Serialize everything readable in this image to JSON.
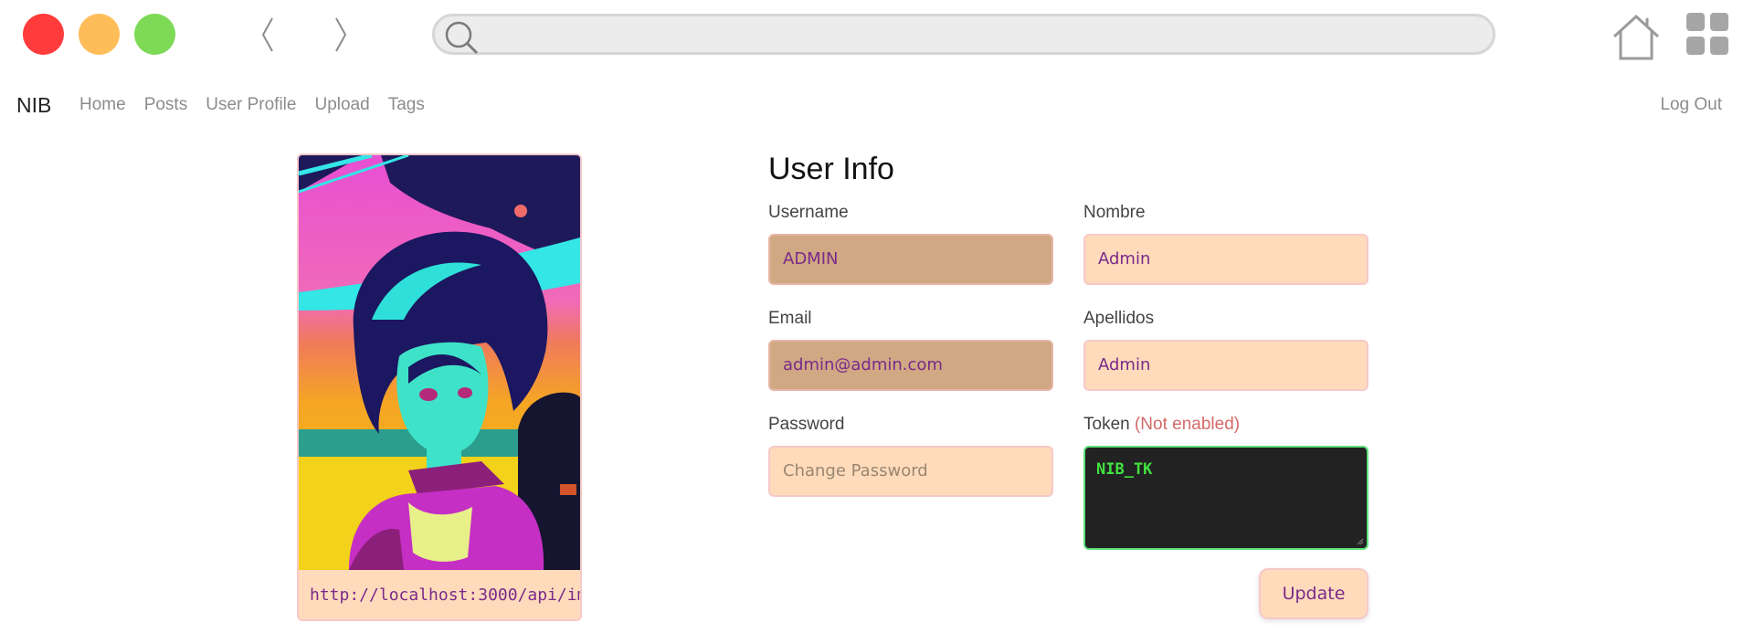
{
  "browser": {
    "icons": {
      "close": "red-dot",
      "minimize": "yellow-dot",
      "maximize": "green-dot",
      "back": "chevron-left-icon",
      "forward": "chevron-right-icon",
      "search": "search-icon",
      "home": "home-icon",
      "apps": "grid-icon"
    },
    "address_value": ""
  },
  "navbar": {
    "brand": "NIB",
    "links": [
      "Home",
      "Posts",
      "User Profile",
      "Upload",
      "Tags"
    ],
    "logout": "Log Out"
  },
  "profile_image": {
    "url_value": "http://localhost:3000/api/ima"
  },
  "form": {
    "title": "User Info",
    "username": {
      "label": "Username",
      "value": "ADMIN"
    },
    "nombre": {
      "label": "Nombre",
      "value": "Admin"
    },
    "email": {
      "label": "Email",
      "value": "admin@admin.com"
    },
    "apellidos": {
      "label": "Apellidos",
      "value": "Admin"
    },
    "password": {
      "label": "Password",
      "placeholder": "Change Password"
    },
    "token": {
      "label": "Token",
      "note": "(Not enabled)",
      "value": "NIB_TK"
    },
    "update_button": "Update"
  },
  "colors": {
    "field_bg": "#ffdbbb",
    "readonly_bg": "#d0a883",
    "field_text": "#7a2a8a",
    "token_bg": "#222222",
    "token_text": "#41e241",
    "note_text": "#d46a6a"
  }
}
